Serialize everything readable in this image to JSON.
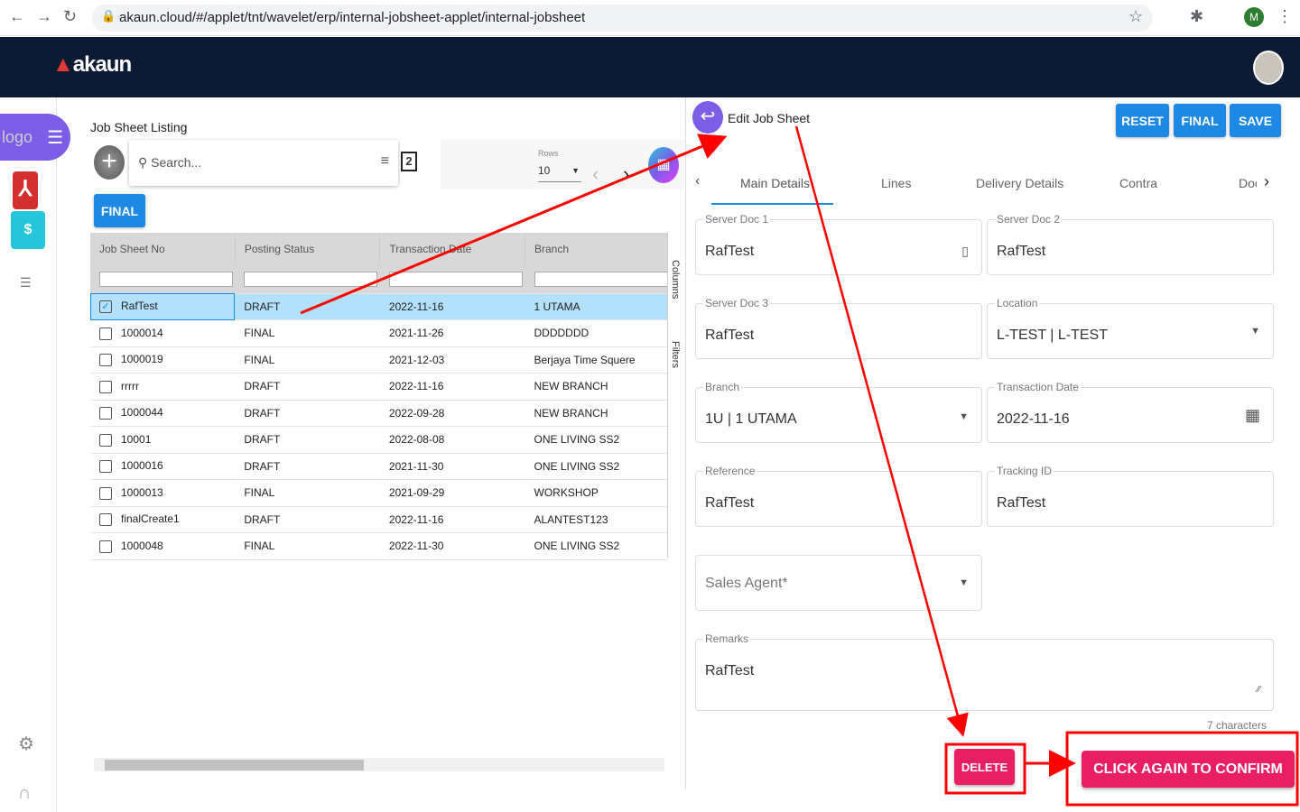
{
  "browser": {
    "url": "akaun.cloud/#/applet/tnt/wavelet/erp/internal-jobsheet-applet/internal-jobsheet",
    "profile_initial": "M"
  },
  "header": {
    "brand": "akaun"
  },
  "sidebar": {
    "logo_alt": "logo"
  },
  "listing": {
    "title": "Job Sheet Listing",
    "search_placeholder": "Search...",
    "rows_label": "Rows",
    "rows_value": "10",
    "final_button": "FINAL",
    "columns": [
      "Job Sheet No",
      "Posting Status",
      "Transaction Date",
      "Branch"
    ],
    "side_tabs": [
      "Columns",
      "Filters"
    ],
    "rows": [
      {
        "no": "RafTest",
        "status": "DRAFT",
        "date": "2022-11-16",
        "branch": "1 UTAMA",
        "checked": true
      },
      {
        "no": "1000014",
        "status": "FINAL",
        "date": "2021-11-26",
        "branch": "DDDDDDD",
        "checked": false
      },
      {
        "no": "1000019",
        "status": "FINAL",
        "date": "2021-12-03",
        "branch": "Berjaya Time Squere",
        "checked": false
      },
      {
        "no": "rrrrr",
        "status": "DRAFT",
        "date": "2022-11-16",
        "branch": "NEW BRANCH",
        "checked": false
      },
      {
        "no": "1000044",
        "status": "DRAFT",
        "date": "2022-09-28",
        "branch": "NEW BRANCH",
        "checked": false
      },
      {
        "no": "10001",
        "status": "DRAFT",
        "date": "2022-08-08",
        "branch": "ONE LIVING SS2",
        "checked": false
      },
      {
        "no": "1000016",
        "status": "DRAFT",
        "date": "2021-11-30",
        "branch": "ONE LIVING SS2",
        "checked": false
      },
      {
        "no": "1000013",
        "status": "FINAL",
        "date": "2021-09-29",
        "branch": "WORKSHOP",
        "checked": false
      },
      {
        "no": "finalCreate1",
        "status": "DRAFT",
        "date": "2022-11-16",
        "branch": "ALANTEST123",
        "checked": false
      },
      {
        "no": "1000048",
        "status": "FINAL",
        "date": "2022-11-30",
        "branch": "ONE LIVING SS2",
        "checked": false
      }
    ]
  },
  "edit": {
    "title": "Edit Job Sheet",
    "buttons": {
      "reset": "RESET",
      "final": "FINAL",
      "save": "SAVE",
      "delete": "DELETE",
      "confirm": "CLICK AGAIN TO CONFIRM"
    },
    "tabs": [
      "Main Details",
      "Lines",
      "Delivery Details",
      "Contra",
      "Doc"
    ],
    "fields": {
      "server_doc_1": {
        "label": "Server Doc 1",
        "value": "RafTest"
      },
      "server_doc_2": {
        "label": "Server Doc 2",
        "value": "RafTest"
      },
      "server_doc_3": {
        "label": "Server Doc 3",
        "value": "RafTest"
      },
      "location": {
        "label": "Location",
        "value": "L-TEST | L-TEST"
      },
      "branch": {
        "label": "Branch",
        "value": "1U | 1 UTAMA"
      },
      "transaction_date": {
        "label": "Transaction Date",
        "value": "2022-11-16"
      },
      "reference": {
        "label": "Reference",
        "value": "RafTest"
      },
      "tracking_id": {
        "label": "Tracking ID",
        "value": "RafTest"
      },
      "sales_agent": {
        "placeholder": "Sales Agent*"
      },
      "remarks": {
        "label": "Remarks",
        "value": "RafTest",
        "counter": "7 characters"
      }
    }
  },
  "colors": {
    "header": "#0c1a33",
    "accent": "#1e88e5",
    "danger": "#e91e63",
    "annotation": "#ff0000"
  }
}
